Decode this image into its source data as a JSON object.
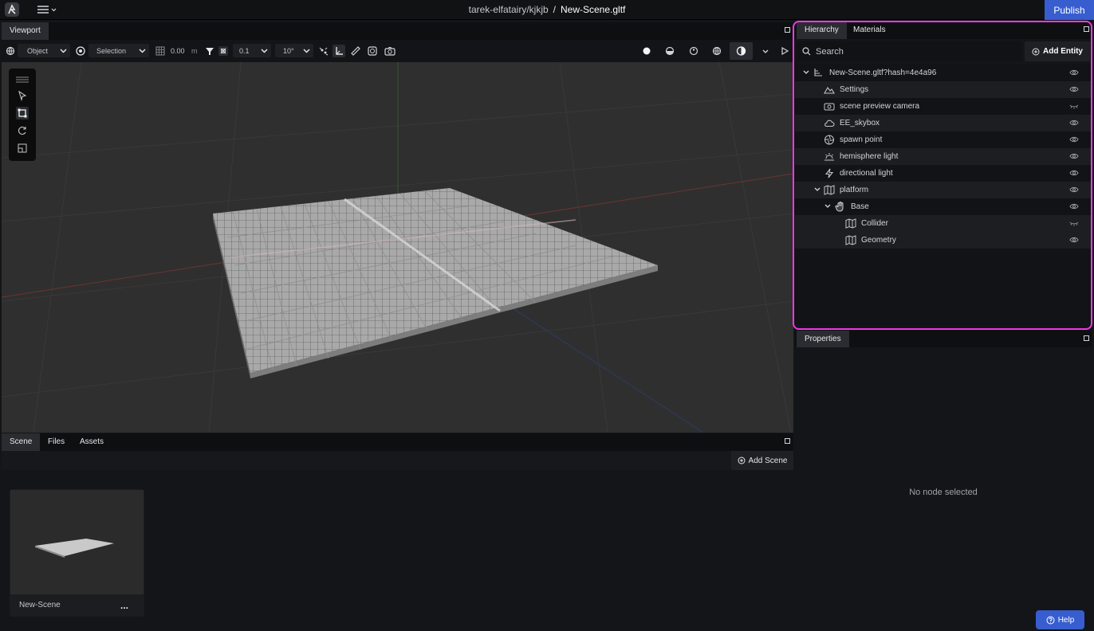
{
  "app": {
    "breadcrumb_project": "tarek-elfatairy/kjkjb",
    "breadcrumb_separator": "/",
    "breadcrumb_file": "New-Scene.gltf",
    "publish_label": "Publish",
    "logo_icon": "ee-logo-icon",
    "menu_icon": "hamburger-menu-icon"
  },
  "viewport": {
    "tab_label": "Viewport",
    "transform_space": "Object",
    "pivot_mode": "Selection",
    "grid_value": "0.00",
    "grid_unit": "m",
    "translation_snap": "0.1",
    "rotation_snap": "10°"
  },
  "bottom_panel": {
    "tabs": [
      "Scene",
      "Files",
      "Assets"
    ],
    "add_scene_label": "Add Scene",
    "scene_card_name": "New-Scene",
    "scene_card_more": "..."
  },
  "hierarchy": {
    "tabs": [
      "Hierarchy",
      "Materials"
    ],
    "search_placeholder": "Search",
    "add_entity_label": "Add Entity",
    "items": [
      {
        "label": "New-Scene.gltf?hash=4e4a96",
        "icon": "scene-root-icon",
        "depth": 0,
        "expanded": true
      },
      {
        "label": "Settings",
        "icon": "mountain-icon",
        "depth": 1
      },
      {
        "label": "scene preview camera",
        "icon": "camera-icon",
        "depth": 1
      },
      {
        "label": "EE_skybox",
        "icon": "cloud-icon",
        "depth": 1
      },
      {
        "label": "spawn point",
        "icon": "aperture-icon",
        "depth": 1
      },
      {
        "label": "hemisphere light",
        "icon": "sunrise-icon",
        "depth": 1
      },
      {
        "label": "directional light",
        "icon": "bolt-icon",
        "depth": 1
      },
      {
        "label": "platform",
        "icon": "map-icon",
        "depth": 1,
        "expanded": true
      },
      {
        "label": "Base",
        "icon": "hand-icon",
        "depth": 2,
        "expanded": true
      },
      {
        "label": "Collider",
        "icon": "map-icon",
        "depth": 3
      },
      {
        "label": "Geometry",
        "icon": "map-icon",
        "depth": 3
      }
    ]
  },
  "properties": {
    "tab_label": "Properties",
    "empty_text": "No node selected"
  },
  "help": {
    "label": "Help"
  },
  "colors": {
    "accent": "#375dcf",
    "highlight": "#ec38e8"
  }
}
